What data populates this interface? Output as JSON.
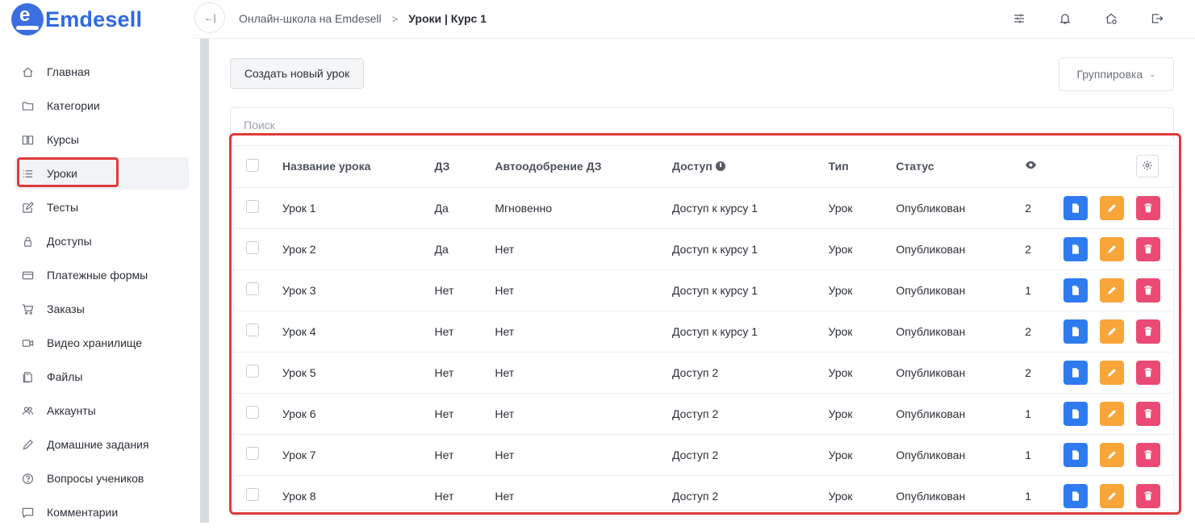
{
  "brand": {
    "name": "Emdesell",
    "letter": "e"
  },
  "sidebar": {
    "items": [
      {
        "label": "Главная",
        "icon": "home-icon"
      },
      {
        "label": "Категории",
        "icon": "folder-icon"
      },
      {
        "label": "Курсы",
        "icon": "book-icon"
      },
      {
        "label": "Уроки",
        "icon": "list-icon",
        "active": true
      },
      {
        "label": "Тесты",
        "icon": "edit-square-icon"
      },
      {
        "label": "Доступы",
        "icon": "lock-icon"
      },
      {
        "label": "Платежные формы",
        "icon": "credit-card-icon"
      },
      {
        "label": "Заказы",
        "icon": "cart-icon"
      },
      {
        "label": "Видео хранилище",
        "icon": "video-icon"
      },
      {
        "label": "Файлы",
        "icon": "file-icon"
      },
      {
        "label": "Аккаунты",
        "icon": "users-icon"
      },
      {
        "label": "Домашние задания",
        "icon": "pencil-icon"
      },
      {
        "label": "Вопросы учеников",
        "icon": "question-circle-icon"
      },
      {
        "label": "Комментарии",
        "icon": "comment-icon"
      }
    ]
  },
  "header": {
    "collapse_label": "←|",
    "breadcrumb": {
      "parent": "Онлайн-школа на Emdesell",
      "separator": ">",
      "current": "Уроки | Курс 1"
    }
  },
  "toolbar": {
    "create_label": "Создать новый урок",
    "group_label": "Группировка"
  },
  "search": {
    "placeholder": "Поиск",
    "value": ""
  },
  "table": {
    "columns": [
      "Название урока",
      "ДЗ",
      "Автоодобрение ДЗ",
      "Доступ",
      "Тип",
      "Статус"
    ],
    "views_icon": "eye-icon",
    "rows": [
      {
        "name": "Урок 1",
        "hw": "Да",
        "auto": "Мгновенно",
        "access": "Доступ к курсу 1",
        "type": "Урок",
        "status": "Опубликован",
        "views": "2"
      },
      {
        "name": "Урок 2",
        "hw": "Да",
        "auto": "Нет",
        "access": "Доступ к курсу 1",
        "type": "Урок",
        "status": "Опубликован",
        "views": "2"
      },
      {
        "name": "Урок 3",
        "hw": "Нет",
        "auto": "Нет",
        "access": "Доступ к курсу 1",
        "type": "Урок",
        "status": "Опубликован",
        "views": "1"
      },
      {
        "name": "Урок 4",
        "hw": "Нет",
        "auto": "Нет",
        "access": "Доступ к курсу 1",
        "type": "Урок",
        "status": "Опубликован",
        "views": "2"
      },
      {
        "name": "Урок 5",
        "hw": "Нет",
        "auto": "Нет",
        "access": "Доступ 2",
        "type": "Урок",
        "status": "Опубликован",
        "views": "2"
      },
      {
        "name": "Урок 6",
        "hw": "Нет",
        "auto": "Нет",
        "access": "Доступ 2",
        "type": "Урок",
        "status": "Опубликован",
        "views": "1"
      },
      {
        "name": "Урок 7",
        "hw": "Нет",
        "auto": "Нет",
        "access": "Доступ 2",
        "type": "Урок",
        "status": "Опубликован",
        "views": "1"
      },
      {
        "name": "Урок 8",
        "hw": "Нет",
        "auto": "Нет",
        "access": "Доступ 2",
        "type": "Урок",
        "status": "Опубликован",
        "views": "1"
      }
    ]
  },
  "colors": {
    "brand": "#2f6ae0",
    "highlight": "#e03a3a",
    "action_view": "#2e7bf0",
    "action_edit": "#f8a53a",
    "action_delete": "#ea4a73"
  }
}
